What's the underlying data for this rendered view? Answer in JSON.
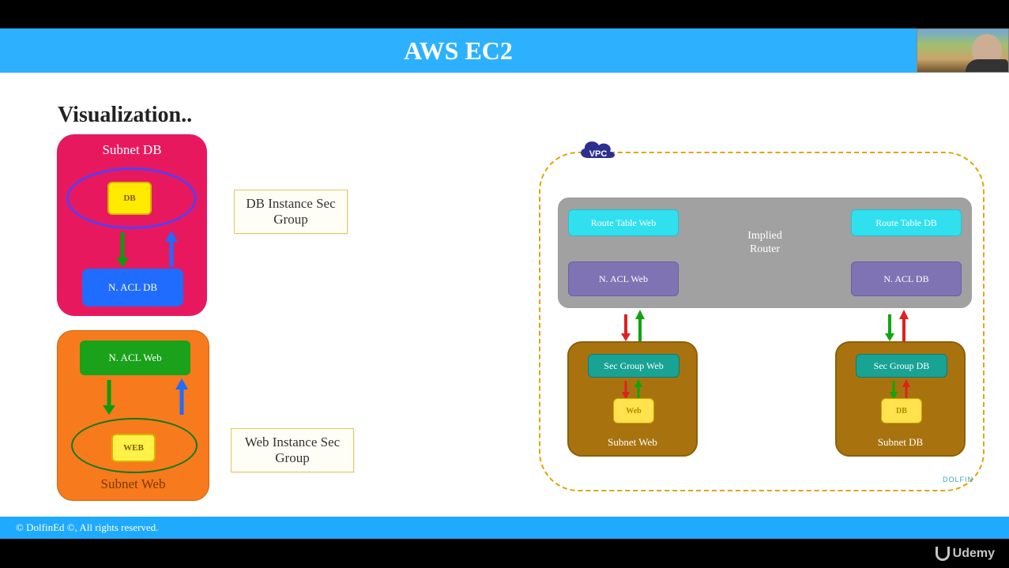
{
  "header": {
    "title": "AWS EC2"
  },
  "slide": {
    "title": "Visualization.."
  },
  "left": {
    "pink": {
      "caption": "Subnet DB",
      "db_box": "DB",
      "nacl": "N. ACL DB"
    },
    "orange": {
      "nacl": "N. ACL Web",
      "web_box": "WEB",
      "caption": "Subnet Web"
    },
    "label_db": "DB Instance Sec Group",
    "label_web": "Web Instance Sec Group"
  },
  "vpc": {
    "badge": "VPC",
    "router_label_line1": "Implied",
    "router_label_line2": "Router",
    "route_table_web": "Route Table Web",
    "route_table_db": "Route Table DB",
    "nacl_web": "N. ACL Web",
    "nacl_db": "N. ACL DB",
    "subnet_web": {
      "sec_group": "Sec Group Web",
      "instance": "Web",
      "caption": "Subnet Web"
    },
    "subnet_db": {
      "sec_group": "Sec Group DB",
      "instance": "DB",
      "caption": "Subnet DB"
    },
    "logo": "DOLFIN"
  },
  "footer": "© DolfinEd ©, All rights reserved.",
  "brand": "Udemy"
}
